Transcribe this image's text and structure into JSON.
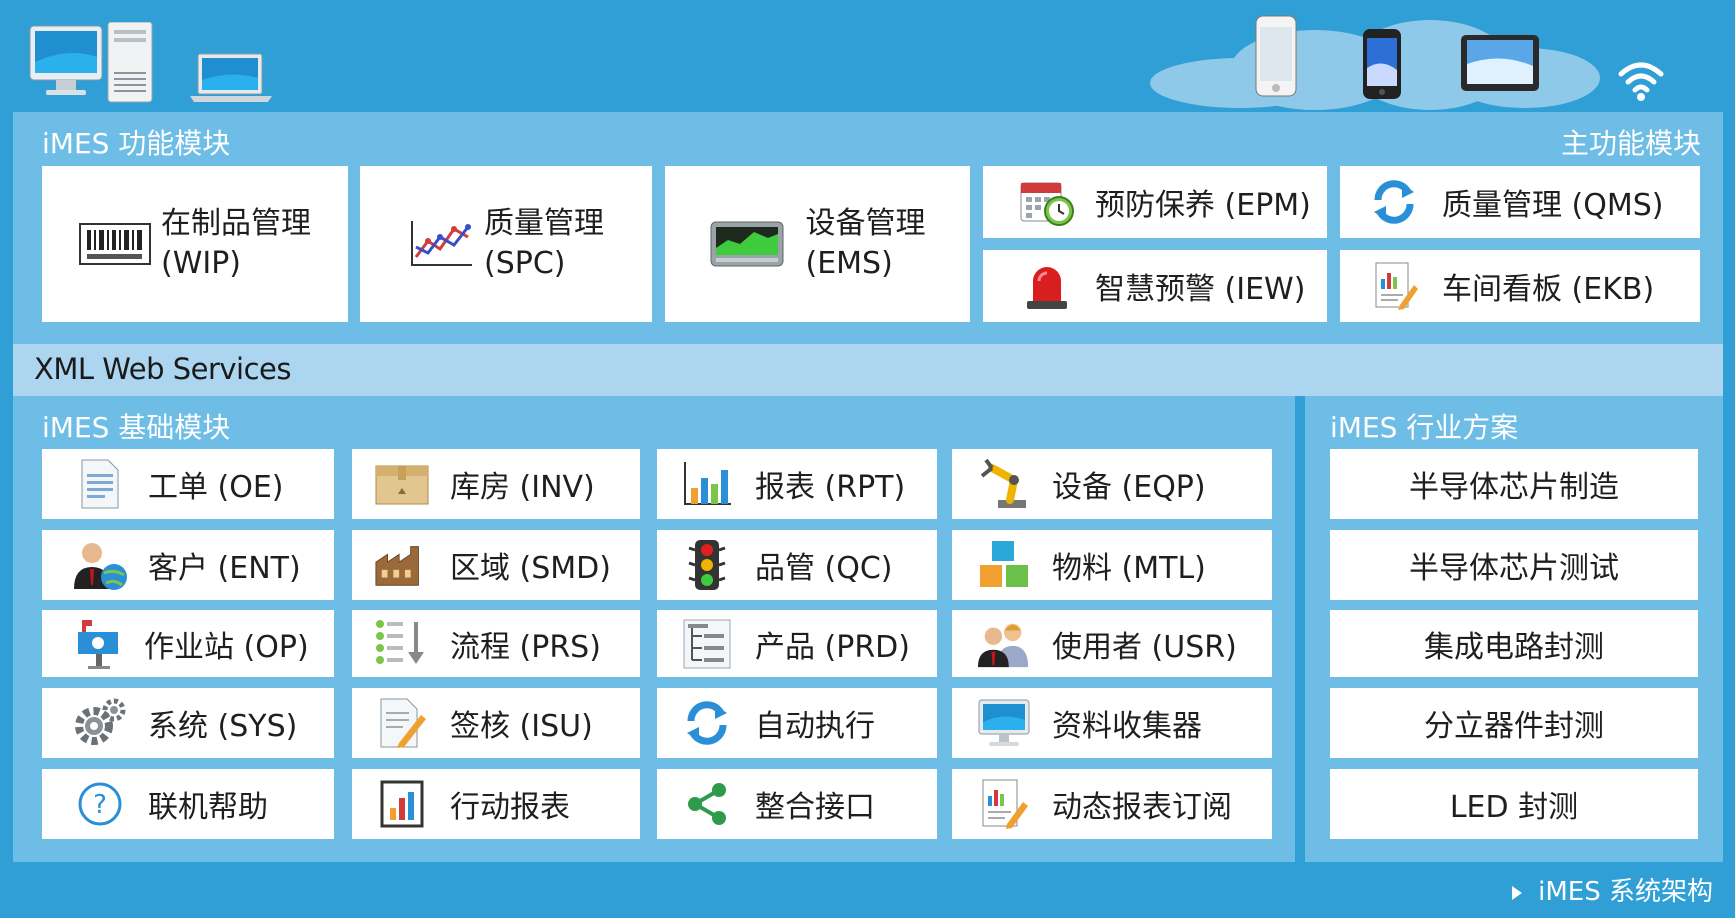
{
  "main_section": {
    "left_title": "iMES 功能模块",
    "right_title": "主功能模块",
    "big_modules": [
      {
        "line1": "在制品管理",
        "line2": "(WIP)",
        "icon": "barcode-icon"
      },
      {
        "line1": "质量管理",
        "line2": "(SPC)",
        "icon": "line-chart-icon"
      },
      {
        "line1": "设备管理",
        "line2": "(EMS)",
        "icon": "equipment-monitor-icon"
      }
    ],
    "small_modules": [
      {
        "label": "预防保养 (EPM)",
        "icon": "calendar-clock-icon"
      },
      {
        "label": "质量管理 (QMS)",
        "icon": "refresh-icon"
      },
      {
        "label": "智慧预警 (IEW)",
        "icon": "alarm-light-icon"
      },
      {
        "label": "车间看板 (EKB)",
        "icon": "report-edit-icon"
      }
    ]
  },
  "xml_bar": {
    "label": "XML Web Services"
  },
  "base_section": {
    "title": "iMES 基础模块",
    "rows": [
      [
        {
          "label": "工单 (OE)",
          "icon": "document-icon"
        },
        {
          "label": "库房 (INV)",
          "icon": "box-icon"
        },
        {
          "label": "报表 (RPT)",
          "icon": "bar-chart-icon"
        },
        {
          "label": "设备 (EQP)",
          "icon": "robot-arm-icon"
        }
      ],
      [
        {
          "label": "客户 (ENT)",
          "icon": "customer-globe-icon"
        },
        {
          "label": "区域 (SMD)",
          "icon": "factory-icon"
        },
        {
          "label": "品管 (QC)",
          "icon": "traffic-light-icon"
        },
        {
          "label": "物料 (MTL)",
          "icon": "cubes-icon"
        }
      ],
      [
        {
          "label": "作业站 (OP)",
          "icon": "mailbox-icon"
        },
        {
          "label": "流程 (PRS)",
          "icon": "process-list-icon"
        },
        {
          "label": "产品 (PRD)",
          "icon": "product-tree-icon"
        },
        {
          "label": "使用者 (USR)",
          "icon": "users-icon"
        }
      ],
      [
        {
          "label": "系统 (SYS)",
          "icon": "gear-icon"
        },
        {
          "label": "签核 (ISU)",
          "icon": "sign-document-icon"
        },
        {
          "label": "自动执行",
          "icon": "refresh-icon"
        },
        {
          "label": "资料收集器",
          "icon": "computer-monitor-icon"
        }
      ],
      [
        {
          "label": "联机帮助",
          "icon": "help-icon"
        },
        {
          "label": "行动报表",
          "icon": "mobile-report-icon"
        },
        {
          "label": "整合接口",
          "icon": "share-icon"
        },
        {
          "label": "动态报表订阅",
          "icon": "report-subscribe-icon"
        }
      ]
    ]
  },
  "industry_section": {
    "title": "iMES 行业方案",
    "items": [
      "半导体芯片制造",
      "半导体芯片测试",
      "集成电路封测",
      "分立器件封测",
      "LED 封测"
    ]
  },
  "footer": {
    "label": "iMES 系统架构"
  },
  "colors": {
    "background": "#2f9fd6",
    "panel": "#6dbde6",
    "xml_bar": "#acd6f0",
    "box": "#ffffff"
  }
}
